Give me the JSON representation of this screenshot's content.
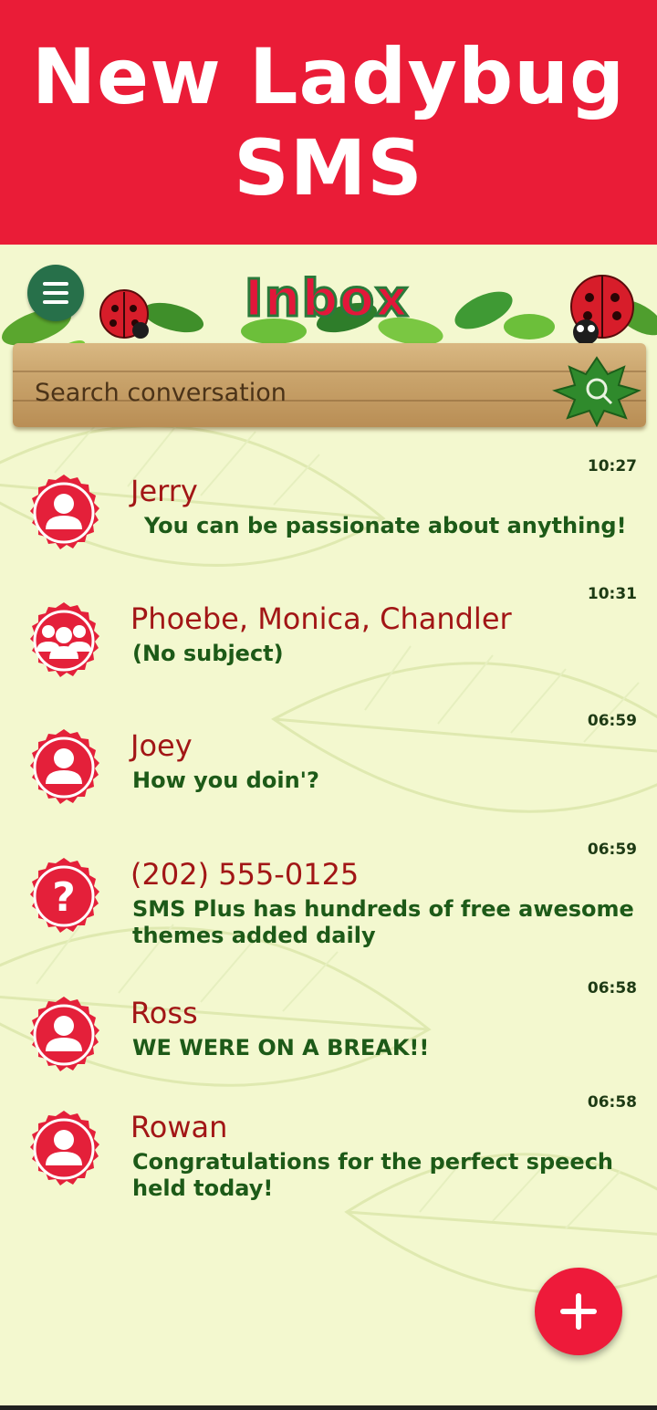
{
  "promo": {
    "line1": "New Ladybug",
    "line2": "SMS"
  },
  "header": {
    "title": "Inbox",
    "menu_icon": "hamburger-menu-icon",
    "search_placeholder": "Search conversation",
    "search_icon": "search-icon"
  },
  "colors": {
    "promo_bg": "#ea1c37",
    "app_bg": "#f3f8cf",
    "name_color": "#a21616",
    "message_color": "#1d5a18",
    "accent_red": "#ee1a3a",
    "menu_green": "#27704a"
  },
  "conversations": [
    {
      "name": "Jerry",
      "message": "You can be passionate about anything!",
      "time": "10:27",
      "avatar": "person-icon"
    },
    {
      "name": "Phoebe, Monica, Chandler",
      "message": "(No subject)",
      "time": "10:31",
      "avatar": "group-icon"
    },
    {
      "name": "Joey",
      "message": "How you doin'?",
      "time": "06:59",
      "avatar": "person-icon"
    },
    {
      "name": "(202) 555-0125",
      "message": "SMS Plus has hundreds of free awesome themes added daily",
      "time": "06:59",
      "avatar": "unknown-contact-icon"
    },
    {
      "name": "Ross",
      "message": "WE WERE ON A BREAK!!",
      "time": "06:58",
      "avatar": "person-icon"
    },
    {
      "name": "Rowan",
      "message": "Congratulations for the perfect speech held today!",
      "time": "06:58",
      "avatar": "person-icon"
    }
  ],
  "fab": {
    "icon": "plus-icon"
  }
}
